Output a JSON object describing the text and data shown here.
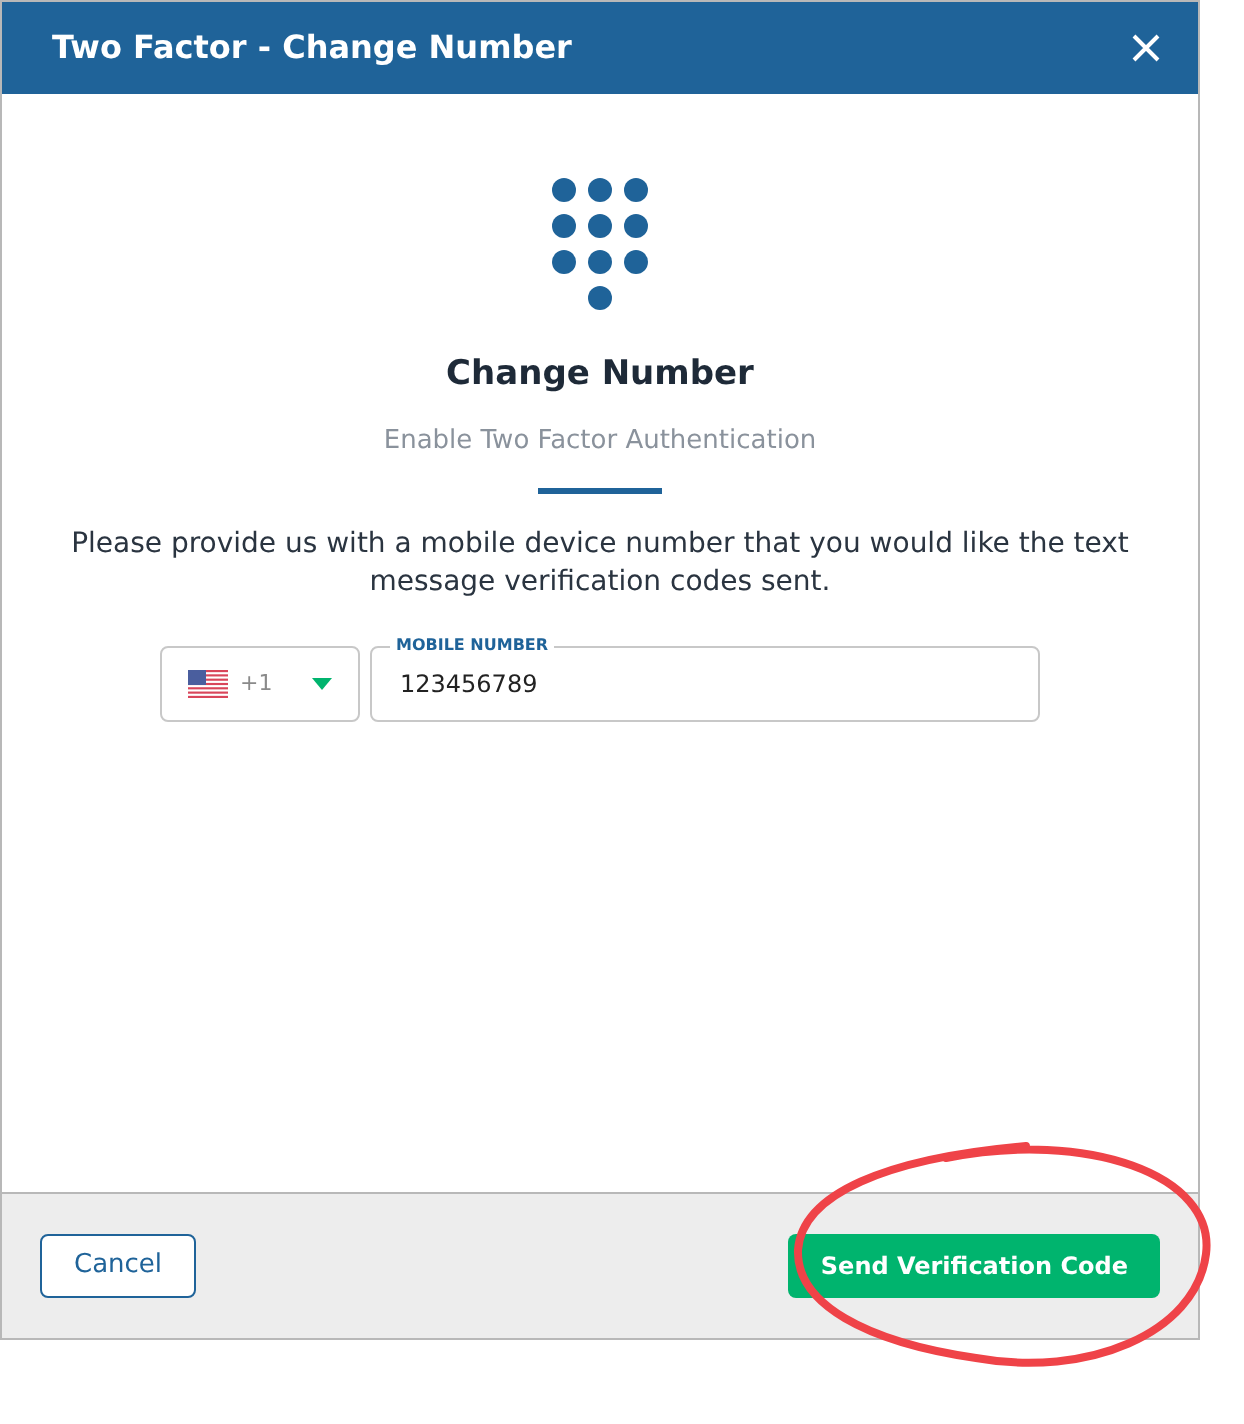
{
  "window": {
    "title": "Two Factor - Change Number"
  },
  "heading": "Change Number",
  "subheading": "Enable Two Factor Authentication",
  "instructions": "Please provide us with a mobile device number that you would like the text message verification codes sent.",
  "country_select": {
    "code": "+1"
  },
  "mobile_field": {
    "label": "MOBILE NUMBER",
    "value": "123456789"
  },
  "buttons": [
    {
      "label": "Cancel",
      "kind": "secondary"
    },
    {
      "label": "Send Verification Code",
      "kind": "primary",
      "highlighted": true
    }
  ]
}
